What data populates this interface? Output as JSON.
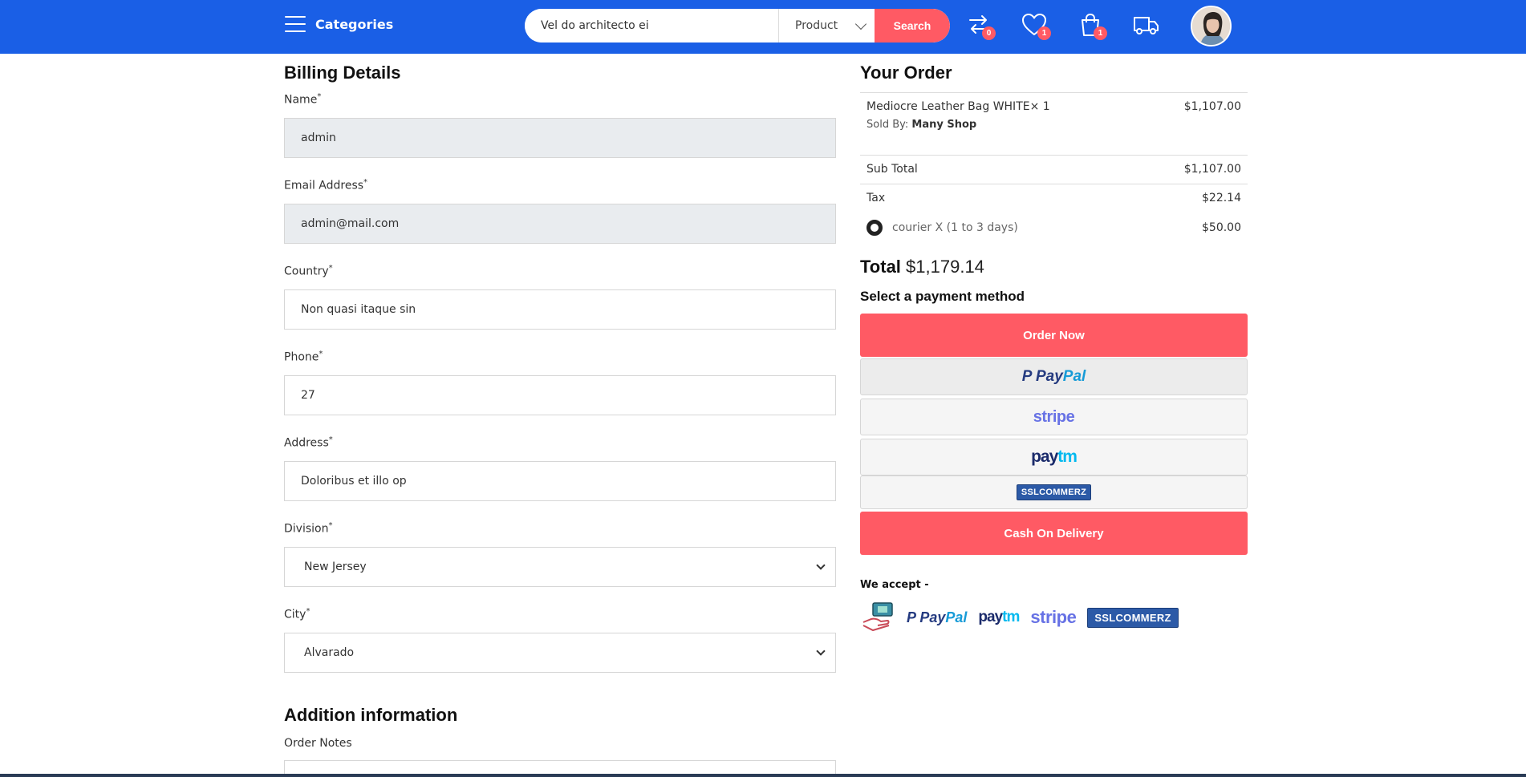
{
  "header": {
    "categories_label": "Categories",
    "search": {
      "value": "Vel do architecto ei",
      "select_value": "Product",
      "button_label": "Search"
    },
    "icons": [
      {
        "name": "compare-icon",
        "count": "0"
      },
      {
        "name": "wishlist-icon",
        "count": "1"
      },
      {
        "name": "cart-icon",
        "count": "1"
      },
      {
        "name": "delivery-truck-icon"
      }
    ],
    "colors": {
      "bar": "#1a5fe6",
      "accent": "#ff5a64"
    }
  },
  "billing": {
    "title": "Billing Details",
    "fields": [
      {
        "label": "Name",
        "required": "*",
        "value": "admin"
      },
      {
        "label": "Email Address",
        "required": "*",
        "value": "admin@mail.com"
      },
      {
        "label": "Country",
        "required": "*",
        "value": "Non quasi itaque sin"
      },
      {
        "label": "Phone",
        "required": "*",
        "value": "27"
      },
      {
        "label": "Address",
        "required": "*",
        "value": "Doloribus et illo op"
      },
      {
        "label": "Division",
        "required": "*",
        "value": "New Jersey"
      },
      {
        "label": "City",
        "required": "*",
        "value": "Alvarado"
      }
    ],
    "addition_title": "Addition information",
    "order_notes_label": "Order Notes"
  },
  "order": {
    "title": "Your Order",
    "item": {
      "name": "Mediocre Leather Bag WHITE× 1",
      "price": "$1,107.00",
      "sold_by_label": "Sold By:",
      "shop": "Many Shop"
    },
    "subtotal": {
      "label": "Sub Total",
      "value": "$1,107.00"
    },
    "tax": {
      "label": "Tax",
      "value": "$22.14"
    },
    "shipping": {
      "label": "courier X (1 to 3 days)",
      "value": "$50.00"
    },
    "total": {
      "label": "Total",
      "value": "$1,179.14"
    },
    "payment_title": "Select a payment method",
    "order_now_label": "Order Now",
    "cod_label": "Cash On Delivery",
    "logos": {
      "paypal_a": "Pay",
      "paypal_b": "Pal",
      "stripe": "stripe",
      "paytm_a": "pay",
      "paytm_b": "tm",
      "ssl": "SSLCOMMERZ"
    },
    "we_accept_label": "We accept -"
  }
}
